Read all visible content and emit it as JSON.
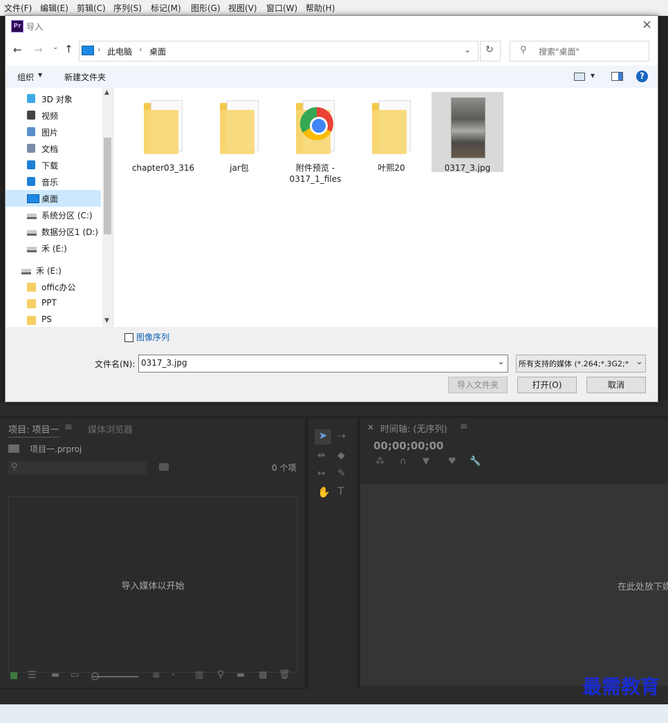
{
  "menu": [
    "文件(F)",
    "编辑(E)",
    "剪辑(C)",
    "序列(S)",
    "标记(M)",
    "图形(G)",
    "视图(V)",
    "窗口(W)",
    "帮助(H)"
  ],
  "dialog": {
    "app_badge": "Pr",
    "title": "导入",
    "breadcrumb": [
      "此电脑",
      "桌面"
    ],
    "search_placeholder": "搜索\"桌面\"",
    "organize_label": "组织",
    "new_folder_label": "新建文件夹",
    "help_glyph": "?",
    "nav_items": [
      {
        "label": "3D 对象",
        "icon": "3d-objects-icon"
      },
      {
        "label": "视频",
        "icon": "video-icon"
      },
      {
        "label": "图片",
        "icon": "pictures-icon"
      },
      {
        "label": "文档",
        "icon": "documents-icon"
      },
      {
        "label": "下载",
        "icon": "download-icon"
      },
      {
        "label": "音乐",
        "icon": "music-icon"
      },
      {
        "label": "桌面",
        "icon": "desktop-icon"
      },
      {
        "label": "系统分区 (C:)",
        "icon": "drive-icon"
      },
      {
        "label": "数据分区1 (D:)",
        "icon": "drive-icon"
      },
      {
        "label": "禾 (E:)",
        "icon": "drive-icon"
      },
      {
        "label": "禾 (E:)",
        "icon": "drive-icon"
      },
      {
        "label": "offic办公",
        "icon": "folder-icon"
      },
      {
        "label": "PPT",
        "icon": "folder-icon"
      },
      {
        "label": "PS",
        "icon": "folder-icon"
      }
    ],
    "files": [
      {
        "name": "chapter03_316",
        "type": "folder"
      },
      {
        "name": "jar包",
        "type": "folder"
      },
      {
        "name": "附件预览 - 0317_1_files",
        "type": "folder-chrome"
      },
      {
        "name": "叶熙20",
        "type": "folder"
      },
      {
        "name": "0317_3.jpg",
        "type": "image"
      }
    ],
    "image_sequence_label": "图像序列",
    "filename_label": "文件名(N):",
    "filename_value": "0317_3.jpg",
    "filetype_value": "所有支持的媒体 (*.264;*.3G2;*",
    "import_folder_label": "导入文件夹",
    "open_label": "打开(O)",
    "cancel_label": "取消"
  },
  "premiere": {
    "project_tab": "项目: 项目一",
    "media_browser_tab": "媒体浏览器",
    "project_file": "项目一.prproj",
    "item_count": "0 个项",
    "import_hint": "导入媒体以开始",
    "timeline_tab": "时间轴: (无序列)",
    "timecode": "00;00;00;00",
    "drop_hint": "在此处放下媒",
    "watermark": "最需教育"
  },
  "colors": {
    "accent": "#0078d7",
    "selected": "#cce8ff",
    "pr_bg": "#232323"
  }
}
